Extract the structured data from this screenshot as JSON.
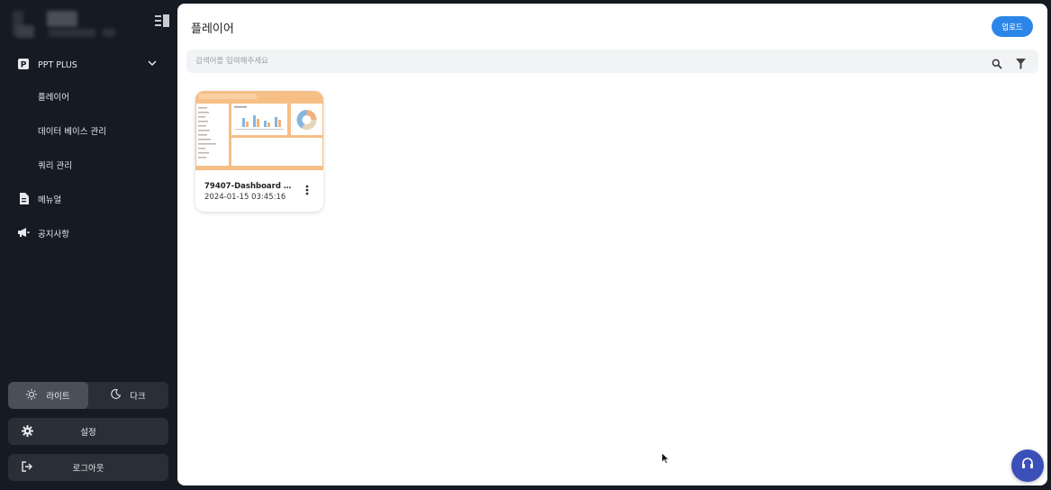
{
  "sidebar": {
    "menu": {
      "title": "PPT PLUS",
      "children": [
        "플레이어",
        "데이터 베이스 관리",
        "쿼리 관리"
      ]
    },
    "items": [
      {
        "label": "메뉴얼",
        "icon": "document-icon"
      },
      {
        "label": "공지사항",
        "icon": "megaphone-icon"
      }
    ],
    "theme": {
      "light": "라이트",
      "dark": "다크",
      "selected": "light"
    },
    "settings_label": "설정",
    "logout_label": "로그아웃"
  },
  "main": {
    "title": "플레이어",
    "upload_label": "업로드",
    "search_placeholder": "검색어를 입력해주세요",
    "cards": [
      {
        "title": "79407-Dashboard P...",
        "date": "2024-01-15 03:45:16"
      }
    ]
  },
  "colors": {
    "accent": "#2c86e8",
    "fab": "#3a4fb8",
    "sidebar_bg": "#151a23",
    "thumb": "#f6bf86"
  }
}
